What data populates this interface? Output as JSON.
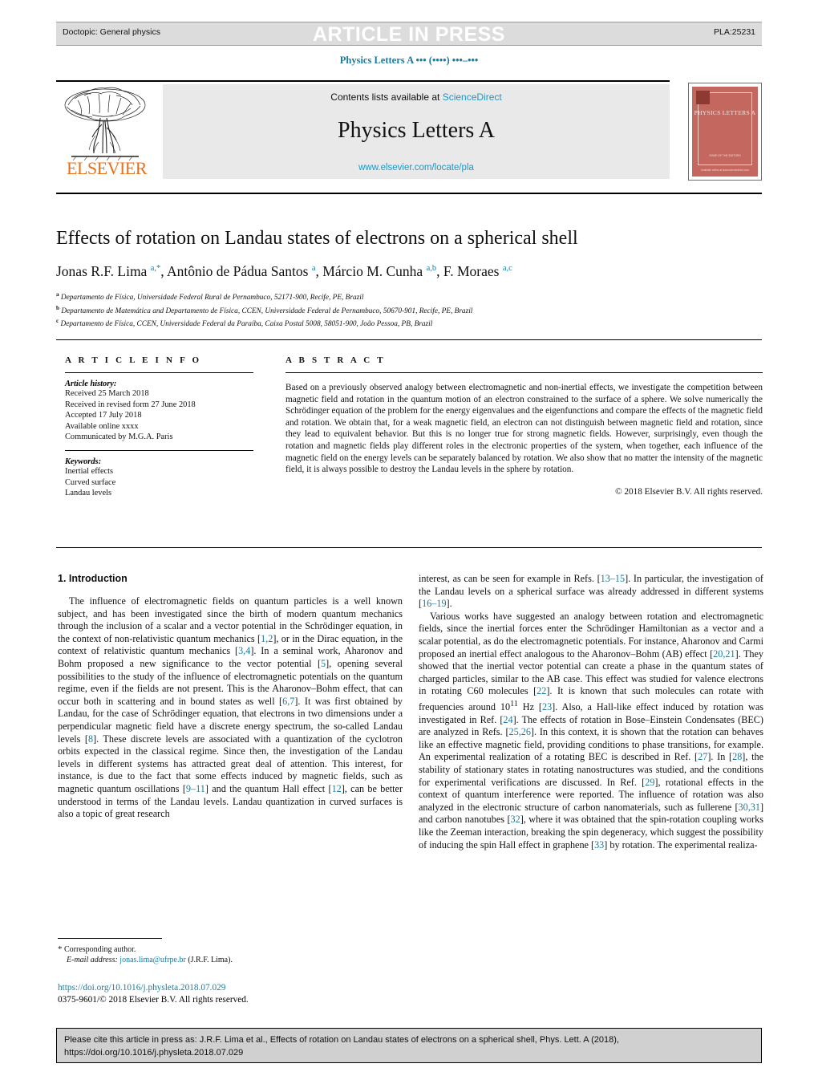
{
  "running_head": {
    "left": "Doctopic: General physics",
    "center": "ARTICLE IN PRESS",
    "right": "PLA:25231"
  },
  "journal_ref_line": "Physics Letters A ••• (••••) •••–•••",
  "masthead": {
    "contents_prefix": "Contents lists available at ",
    "sciencedirect": "ScienceDirect",
    "journal_title": "Physics Letters A",
    "journal_url": "www.elsevier.com/locate/pla",
    "publisher": "ELSEVIER"
  },
  "cover": {
    "title": "PHYSICS LETTERS A",
    "foot_line1": "SOME OF THE EDITORS",
    "foot_line2": "Editorial list",
    "foot_line3": "Available online at www.sciencedirect.com"
  },
  "article": {
    "title": "Effects of rotation on Landau states of electrons on a spherical shell",
    "authors_html": "Jonas R.F. Lima <sup>a,*</sup>, Antônio de Pádua Santos <sup>a</sup>, Márcio M. Cunha <sup>a,b</sup>, F. Moraes <sup>a,c</sup>",
    "affiliations": [
      {
        "marker": "a",
        "text": "Departamento de Física, Universidade Federal Rural de Pernambuco, 52171-900, Recife, PE, Brazil"
      },
      {
        "marker": "b",
        "text": "Departamento de Matemática and Departamento de Física, CCEN, Universidade Federal de Pernambuco, 50670-901, Recife, PE, Brazil"
      },
      {
        "marker": "c",
        "text": "Departamento de Física, CCEN, Universidade Federal da Paraíba, Caixa Postal 5008, 58051-900, João Pessoa, PB, Brazil"
      }
    ]
  },
  "article_info": {
    "heading": "A R T I C L E I N F O",
    "history_label": "Article history:",
    "history": [
      "Received 25 March 2018",
      "Received in revised form 27 June 2018",
      "Accepted 17 July 2018",
      "Available online xxxx",
      "Communicated by M.G.A. Paris"
    ],
    "keywords_label": "Keywords:",
    "keywords": [
      "Inertial effects",
      "Curved surface",
      "Landau levels"
    ]
  },
  "abstract": {
    "heading": "A B S T R A C T",
    "body": "Based on a previously observed analogy between electromagnetic and non-inertial effects, we investigate the competition between magnetic field and rotation in the quantum motion of an electron constrained to the surface of a sphere. We solve numerically the Schrödinger equation of the problem for the energy eigenvalues and the eigenfunctions and compare the effects of the magnetic field and rotation. We obtain that, for a weak magnetic field, an electron can not distinguish between magnetic field and rotation, since they lead to equivalent behavior. But this is no longer true for strong magnetic fields. However, surprisingly, even though the rotation and magnetic fields play different roles in the electronic properties of the system, when together, each influence of the magnetic field on the energy levels can be separately balanced by rotation. We also show that no matter the intensity of the magnetic field, it is always possible to destroy the Landau levels in the sphere by rotation.",
    "copyright": "© 2018 Elsevier B.V. All rights reserved."
  },
  "body": {
    "section_heading": "1. Introduction",
    "left_paragraphs": [
      "The influence of electromagnetic fields on quantum particles is a well known subject, and has been investigated since the birth of modern quantum mechanics through the inclusion of a scalar and a vector potential in the Schrödinger equation, in the context of non-relativistic quantum mechanics [1,2], or in the Dirac equation, in the context of relativistic quantum mechanics [3,4]. In a seminal work, Aharonov and Bohm proposed a new significance to the vector potential [5], opening several possibilities to the study of the influence of electromagnetic potentials on the quantum regime, even if the fields are not present. This is the Aharonov–Bohm effect, that can occur both in scattering and in bound states as well [6,7]. It was first obtained by Landau, for the case of Schrödinger equation, that electrons in two dimensions under a perpendicular magnetic field have a discrete energy spectrum, the so-called Landau levels [8]. These discrete levels are associated with a quantization of the cyclotron orbits expected in the classical regime. Since then, the investigation of the Landau levels in different systems has attracted great deal of attention. This interest, for instance, is due to the fact that some effects induced by magnetic fields, such as magnetic quantum oscillations [9–11] and the quantum Hall effect [12], can be better understood in terms of the Landau levels. Landau quantization in curved surfaces is also a topic of great research"
    ],
    "right_paragraphs": [
      "interest, as can be seen for example in Refs. [13–15]. In particular, the investigation of the Landau levels on a spherical surface was already addressed in different systems [16–19].",
      "Various works have suggested an analogy between rotation and electromagnetic fields, since the inertial forces enter the Schrödinger Hamiltonian as a vector and a scalar potential, as do the electromagnetic potentials. For instance, Aharonov and Carmi proposed an inertial effect analogous to the Aharonov–Bohm (AB) effect [20,21]. They showed that the inertial vector potential can create a phase in the quantum states of charged particles, similar to the AB case. This effect was studied for valence electrons in rotating C60 molecules [22]. It is known that such molecules can rotate with frequencies around 10<sup>11</sup> Hz [23]. Also, a Hall-like effect induced by rotation was investigated in Ref. [24]. The effects of rotation in Bose–Einstein Condensates (BEC) are analyzed in Refs. [25,26]. In this context, it is shown that the rotation can behaves like an effective magnetic field, providing conditions to phase transitions, for example. An experimental realization of a rotating BEC is described in Ref. [27]. In [28], the stability of stationary states in rotating nanostructures was studied, and the conditions for experimental verifications are discussed. In Ref. [29], rotational effects in the context of quantum interference were reported. The influence of rotation was also analyzed in the electronic structure of carbon nanomaterials, such as fullerene [30,31] and carbon nanotubes [32], where it was obtained that the spin-rotation coupling works like the Zeeman interaction, breaking the spin degeneracy, which suggest the possibility of inducing the spin Hall effect in graphene [33] by rotation. The experimental realiza-"
    ]
  },
  "footnote": {
    "star": "*",
    "corresponding": "Corresponding author.",
    "email_label": "E-mail address:",
    "email": "jonas.lima@ufrpe.br",
    "email_owner": "(J.R.F. Lima)."
  },
  "doi_block": {
    "doi_url": "https://doi.org/10.1016/j.physleta.2018.07.029",
    "issn_line": "0375-9601/© 2018 Elsevier B.V. All rights reserved."
  },
  "cite_box": {
    "line1": "Please cite this article in press as: J.R.F. Lima et al., Effects of rotation on Landau states of electrons on a spherical shell, Phys. Lett. A (2018),",
    "line2": "https://doi.org/10.1016/j.physleta.2018.07.029"
  },
  "colors": {
    "link": "#1a7b9e",
    "sciencedirect": "#2196c4",
    "elsevier_orange": "#e8711a",
    "cover_red": "#c4675e",
    "runhead_grey": "#dcdcdc",
    "cite_grey": "#d0d0d0"
  }
}
